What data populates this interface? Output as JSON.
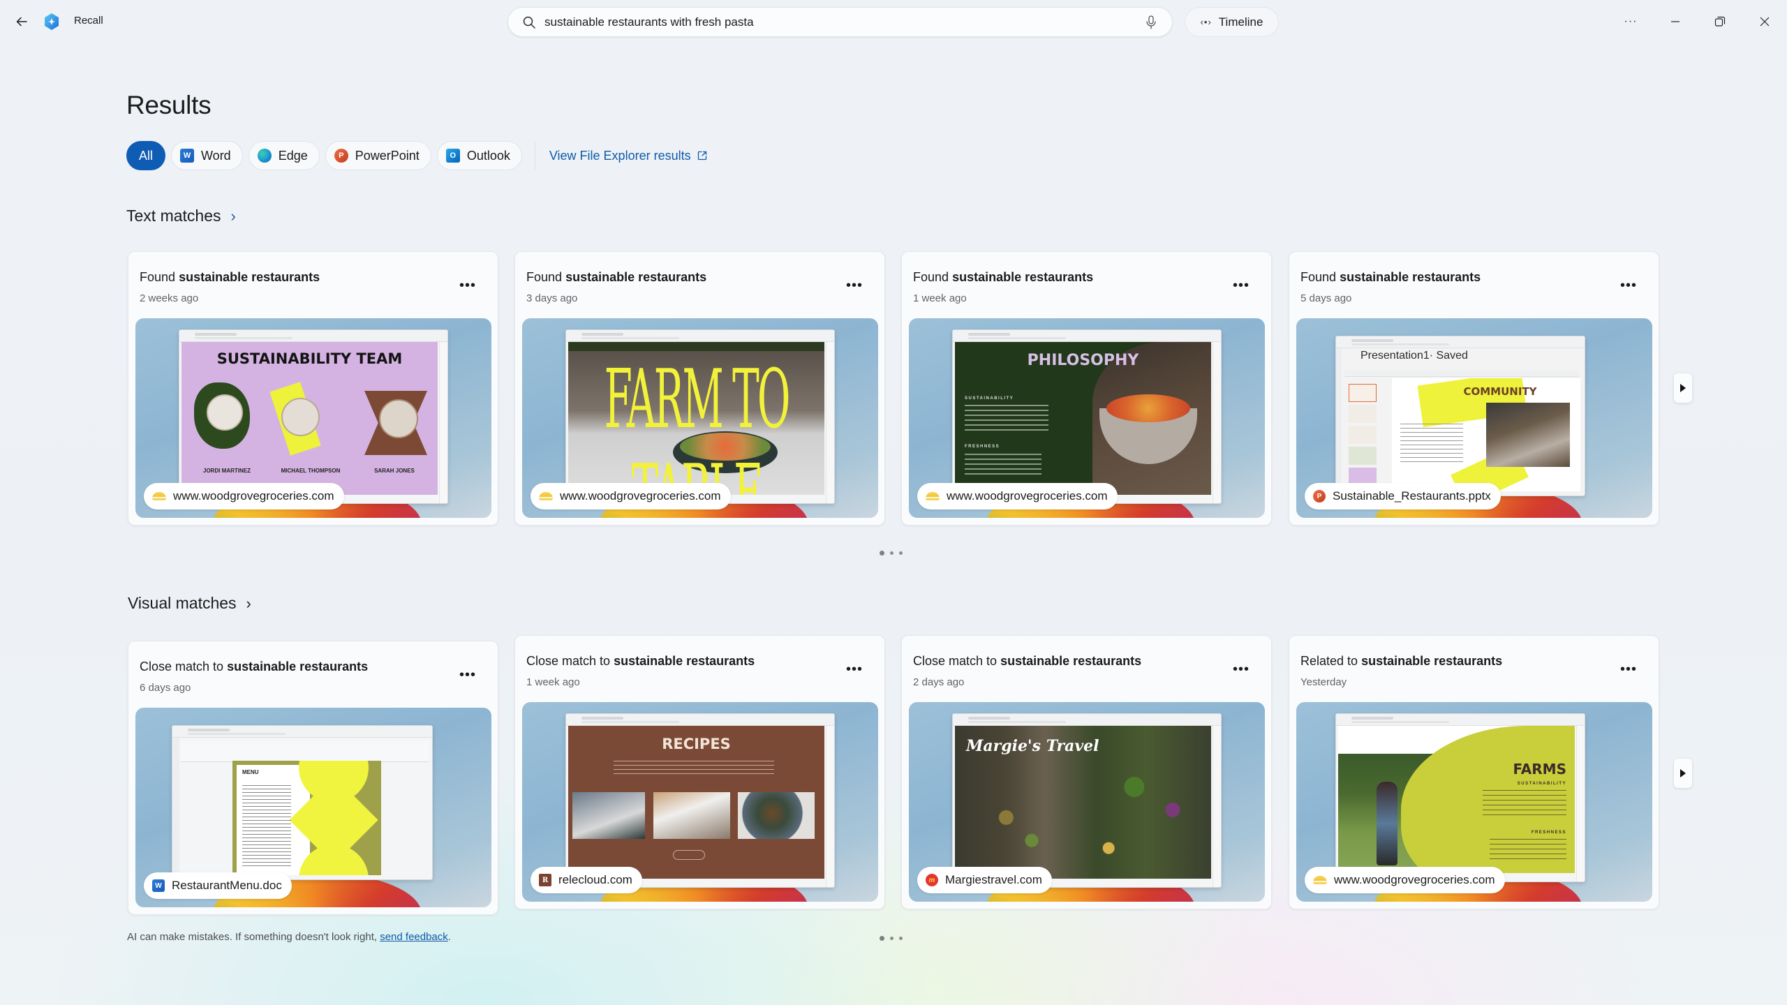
{
  "app": {
    "name": "Recall",
    "back_icon": "arrow-left-icon",
    "logo_icon": "recall-logo-icon"
  },
  "search": {
    "value": "sustainable restaurants with fresh pasta",
    "placeholder": "",
    "icon": "search-icon",
    "mic_icon": "microphone-icon"
  },
  "timeline": {
    "label": "Timeline",
    "icon": "code-brackets-icon"
  },
  "window_controls": {
    "more": "more-options-icon",
    "minimize": "minimize-icon",
    "restore": "restore-icon",
    "close": "close-icon"
  },
  "page": {
    "title": "Results"
  },
  "filters": {
    "items": [
      {
        "label": "All",
        "active": true,
        "icon": ""
      },
      {
        "label": "Word",
        "active": false,
        "icon": "word-icon"
      },
      {
        "label": "Edge",
        "active": false,
        "icon": "edge-icon"
      },
      {
        "label": "PowerPoint",
        "active": false,
        "icon": "powerpoint-icon"
      },
      {
        "label": "Outlook",
        "active": false,
        "icon": "outlook-icon"
      }
    ],
    "file_explorer_link": "View File Explorer results",
    "file_explorer_icon": "open-external-icon"
  },
  "text_matches": {
    "title": "Text matches",
    "pager": {
      "pages": 3,
      "current": 1
    },
    "cards": [
      {
        "prefix": "Found",
        "query": "sustainable restaurants",
        "time": "2 weeks ago",
        "source": "www.woodgrovegroceries.com",
        "source_icon": "woodgrove-icon",
        "preview_title": "SUSTAINABILITY TEAM",
        "preview_people": [
          "JORDI MARTINEZ",
          "MICHAEL THOMPSON",
          "SARAH JONES"
        ]
      },
      {
        "prefix": "Found",
        "query": "sustainable restaurants",
        "time": "3 days ago",
        "source": "www.woodgrovegroceries.com",
        "source_icon": "woodgrove-icon",
        "preview_title": "FARM TO TABLE"
      },
      {
        "prefix": "Found",
        "query": "sustainable restaurants",
        "time": "1 week ago",
        "source": "www.woodgrovegroceries.com",
        "source_icon": "woodgrove-icon",
        "preview_title": "PHILOSOPHY",
        "preview_sections": [
          "SUSTAINABILITY",
          "FRESHNESS"
        ]
      },
      {
        "prefix": "Found",
        "query": "sustainable restaurants",
        "time": "5 days ago",
        "source": "Sustainable_Restaurants.pptx",
        "source_icon": "powerpoint-icon",
        "preview_title": "COMMUNITY",
        "preview_doc_title": "Presentation1· Saved"
      }
    ]
  },
  "visual_matches": {
    "title": "Visual matches",
    "pager": {
      "pages": 3,
      "current": 1
    },
    "cards": [
      {
        "prefix": "Close match to",
        "query": "sustainable restaurants",
        "time": "6 days ago",
        "source": "RestaurantMenu.doc",
        "source_icon": "word-icon",
        "preview_title": "MENU"
      },
      {
        "prefix": "Close match to",
        "query": "sustainable restaurants",
        "time": "1 week ago",
        "source": "relecloud.com",
        "source_icon": "relecloud-icon",
        "preview_title": "RECIPES"
      },
      {
        "prefix": "Close match to",
        "query": "sustainable restaurants",
        "time": "2 days ago",
        "source": "Margiestravel.com",
        "source_icon": "margies-travel-icon",
        "preview_title": "Margie's Travel"
      },
      {
        "prefix": "Related to",
        "query": "sustainable restaurants",
        "time": "Yesterday",
        "source": "www.woodgrovegroceries.com",
        "source_icon": "woodgrove-icon",
        "preview_title": "FARMS",
        "preview_sections": [
          "SUSTAINABILITY",
          "FRESHNESS"
        ]
      }
    ]
  },
  "footer": {
    "text": "AI can make mistakes. If something doesn't look right, ",
    "link": "send feedback",
    "end": "."
  },
  "colors": {
    "accent": "#0f5cb5",
    "link": "#0f5aa8"
  }
}
